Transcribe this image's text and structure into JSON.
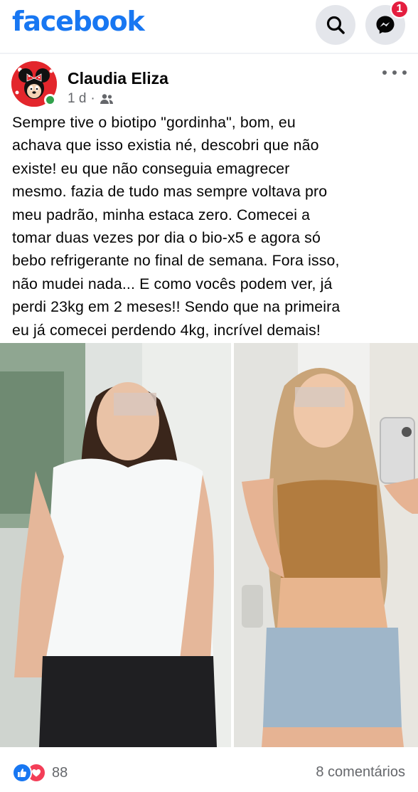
{
  "app": {
    "logo_text": "facebook",
    "brand_color": "#1877f2"
  },
  "header": {
    "search_icon": "search-icon",
    "messenger_icon": "messenger-icon",
    "messenger_badge": "1"
  },
  "post": {
    "author": "Claudia Eliza",
    "time": "1 d",
    "audience_icon": "friends-icon",
    "options_icon": "more-options-icon",
    "text": "Sempre tive o biotipo \"gordinha\", bom, eu\nachava que isso existia né, descobri que não\nexiste! eu que não conseguia emagrecer\nmesmo. fazia de tudo mas sempre voltava pro\nmeu padrão, minha estaca zero. Comecei a\ntomar duas vezes por dia o bio-x5 e agora só\nbebo refrigerante no final de semana. Fora isso,\nnão mudei nada... E como vocês podem ver, já\nperdi 23kg em 2 meses!! Sendo que na primeira\neu já comecei perdendo 4kg, incrível demais!",
    "reaction_count": "88",
    "comments_label": "8 comentários"
  }
}
